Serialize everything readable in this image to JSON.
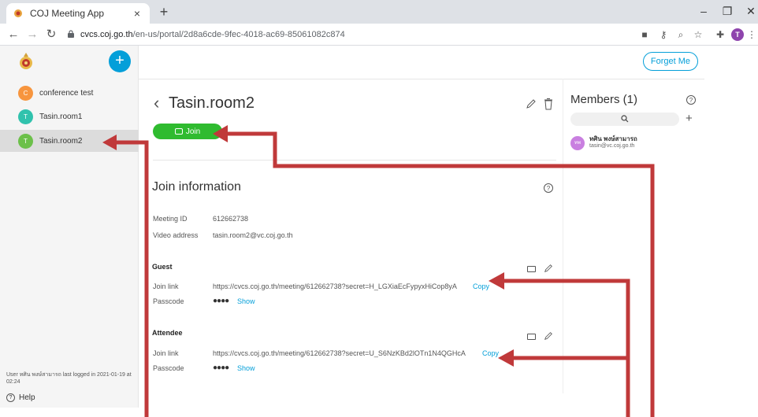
{
  "browser": {
    "tab_title": "COJ Meeting App",
    "tab_close": "×",
    "new_tab": "+",
    "url_host": "cvcs.coj.go.th",
    "url_path": "/en-us/portal/2d8a6cde-9fec-4018-ac69-85061082c874",
    "profile_initial": "T"
  },
  "sidebar": {
    "plus": "+",
    "rooms": [
      {
        "initial": "C",
        "label": "conference test",
        "color": "#f7953e"
      },
      {
        "initial": "T",
        "label": "Tasin.room1",
        "color": "#30c2ad"
      },
      {
        "initial": "T",
        "label": "Tasin.room2",
        "color": "#6cc04a"
      }
    ],
    "last_login": "User ทศิน พงษ์สามารถ last logged in 2021-01-19 at 02:24",
    "help": "Help"
  },
  "header": {
    "forget_me": "Forget Me"
  },
  "room": {
    "title": "Tasin.room2",
    "join": "Join"
  },
  "join_info": {
    "title": "Join information",
    "meeting_id_label": "Meeting ID",
    "meeting_id": "612662738",
    "video_address_label": "Video address",
    "video_address": "tasin.room2@vc.coj.go.th",
    "guest": {
      "heading": "Guest",
      "join_link_label": "Join link",
      "join_link": "https://cvcs.coj.go.th/meeting/612662738?secret=H_LGXiaEcFypyxHiCop8yA",
      "copy": "Copy",
      "passcode_label": "Passcode",
      "passcode_mask": "●●●●",
      "show": "Show"
    },
    "attendee": {
      "heading": "Attendee",
      "join_link_label": "Join link",
      "join_link": "https://cvcs.coj.go.th/meeting/612662738?secret=U_S6NzKBd2lOTn1N4QGHcA",
      "copy": "Copy",
      "passcode_label": "Passcode",
      "passcode_mask": "●●●●",
      "show": "Show"
    }
  },
  "members": {
    "title": "Members (1)",
    "add": "+",
    "list": [
      {
        "avatar": "ทพ",
        "name": "ทศิน พงษ์สามารถ",
        "email": "tasin@vc.coj.go.th"
      }
    ]
  },
  "colors": {
    "accent": "#049fd9",
    "join_green": "#2fbb2f",
    "arrow_red": "#c0393a"
  }
}
